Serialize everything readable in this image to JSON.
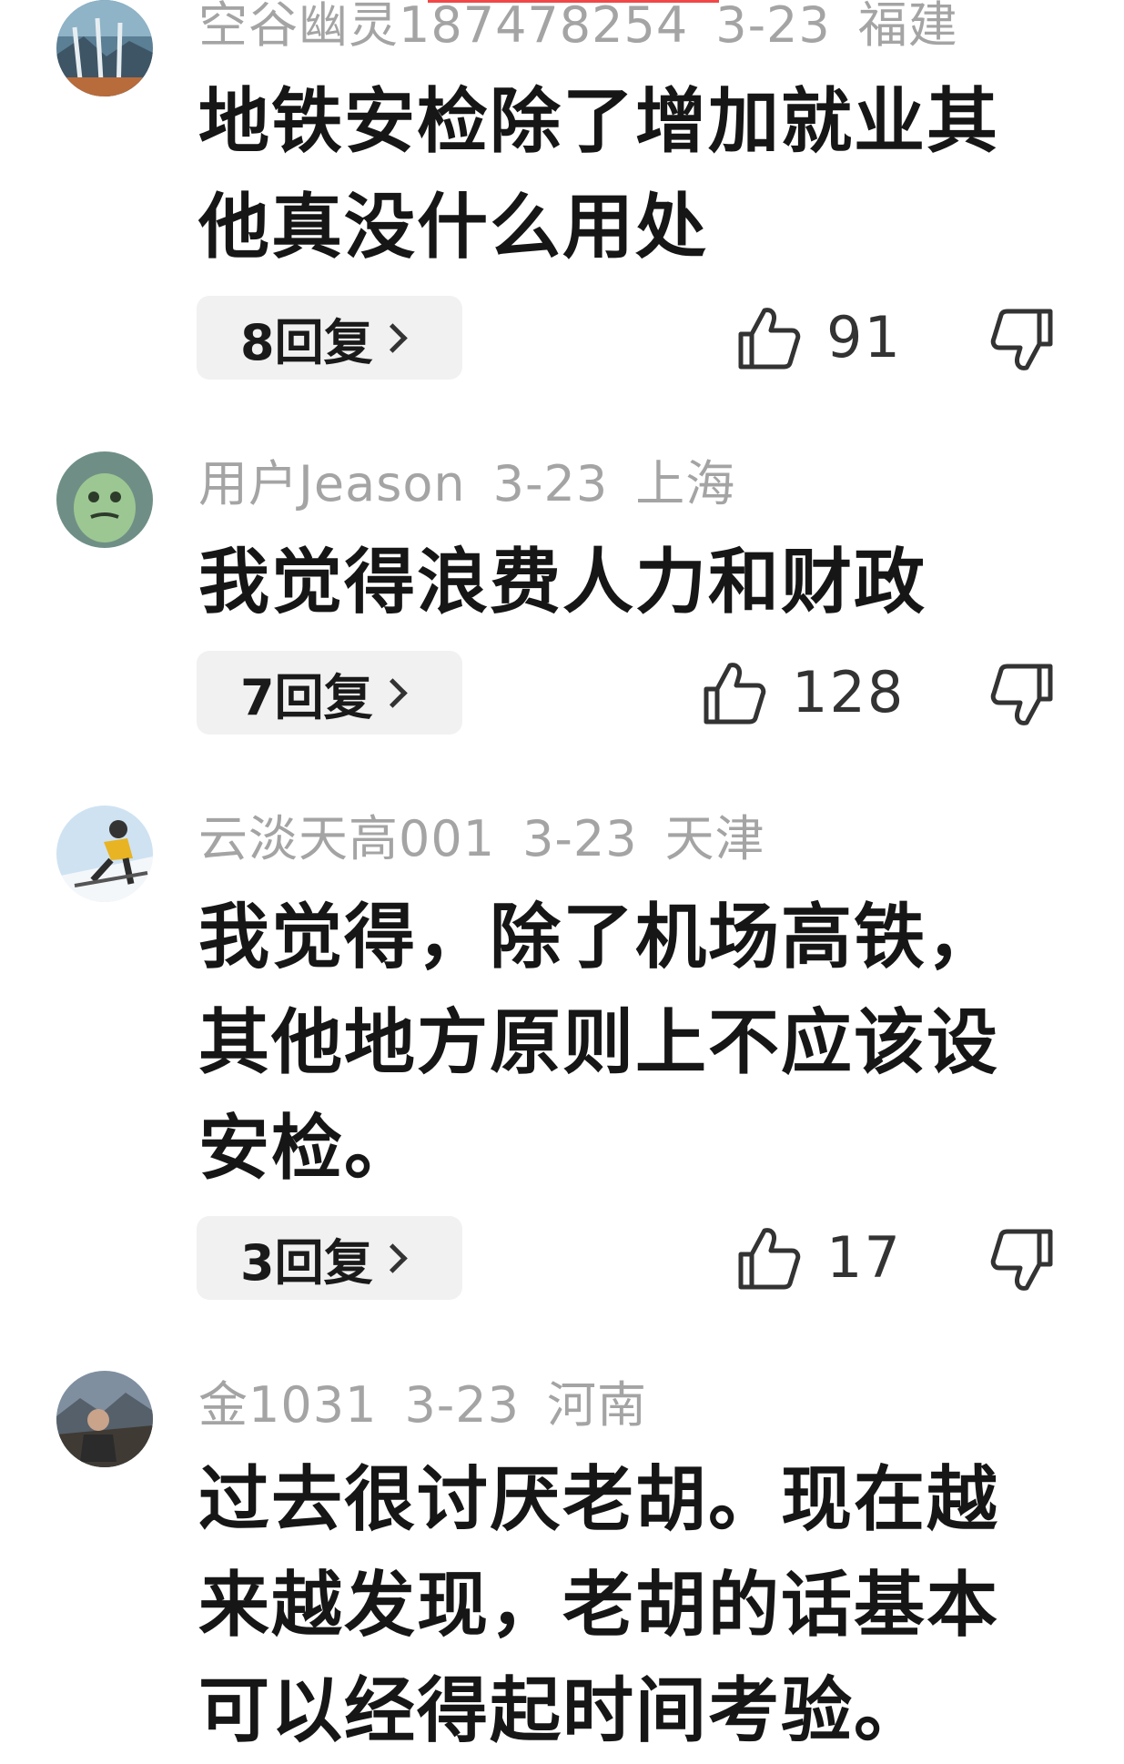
{
  "comments": [
    {
      "username": "空谷幽灵187478254",
      "date": "3-23",
      "location": "福建",
      "text": "地铁安检除了增加就业其\n他真没什么用处",
      "replies": "8回复",
      "likes": "91"
    },
    {
      "username": "用户Jeason",
      "date": "3-23",
      "location": "上海",
      "text": "我觉得浪费人力和财政",
      "replies": "7回复",
      "likes": "128"
    },
    {
      "username": "云淡天高001",
      "date": "3-23",
      "location": "天津",
      "text": "我觉得，除了机场高铁，\n其他地方原则上不应该设\n安检。",
      "replies": "3回复",
      "likes": "17"
    },
    {
      "username": "金1031",
      "date": "3-23",
      "location": "河南",
      "text": "过去很讨厌老胡。现在越\n来越发现，老胡的话基本\n可以经得起时间考验。"
    }
  ],
  "icons": {
    "like": "thumbs-up-icon",
    "dislike": "thumbs-down-icon",
    "reply_chevron": "chevron-right-icon"
  },
  "colors": {
    "meta": "#a4a4a4",
    "text": "#161616",
    "pill_bg": "#f1f1f1",
    "accent": "#f04848"
  }
}
